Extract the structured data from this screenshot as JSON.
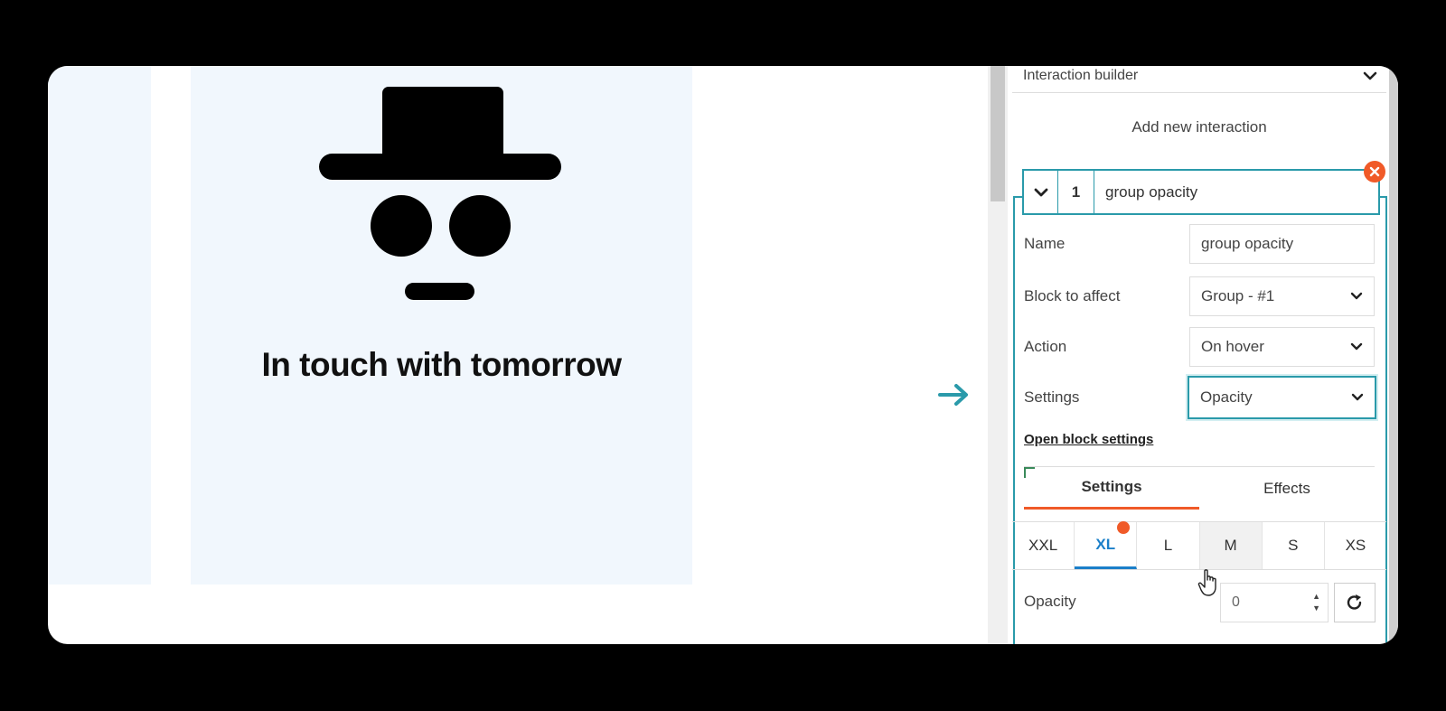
{
  "canvas": {
    "card_title": "In touch with tomorrow"
  },
  "builder": {
    "header_title": "Interaction builder",
    "add_button": "Add new interaction"
  },
  "interaction": {
    "index": "1",
    "title": "group opacity",
    "fields": {
      "name_label": "Name",
      "name_value": "group opacity",
      "block_label": "Block to affect",
      "block_value": "Group - #1",
      "action_label": "Action",
      "action_value": "On hover",
      "settings_label": "Settings",
      "settings_value": "Opacity"
    },
    "open_block_settings": "Open block settings",
    "tabs": [
      "Settings",
      "Effects"
    ],
    "breakpoints": [
      "XXL",
      "XL",
      "L",
      "M",
      "S",
      "XS"
    ],
    "opacity_label": "Opacity",
    "opacity_value": "0"
  },
  "colors": {
    "accent_teal": "#2a9aaa",
    "accent_orange": "#f05a28",
    "active_blue": "#1b7fc9"
  },
  "icons": [
    "chevron-down-icon",
    "close-icon",
    "arrow-right-icon",
    "reset-icon",
    "pointer-hand-icon"
  ]
}
